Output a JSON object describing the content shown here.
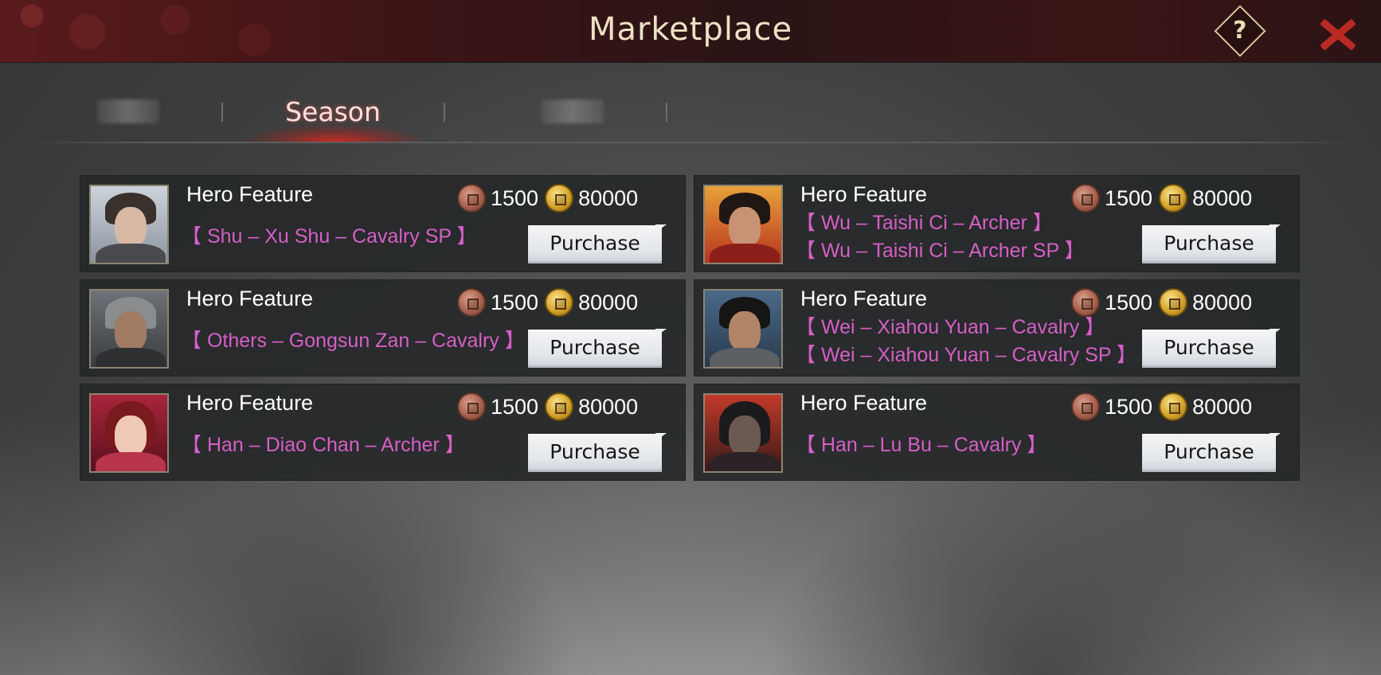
{
  "header": {
    "title": "Marketplace",
    "help_label": "?",
    "help_icon": "help-icon",
    "close_icon": "close-icon",
    "accent_color": "#b92a24"
  },
  "tabs": [
    {
      "label": "",
      "active": false,
      "obscured": true
    },
    {
      "label": "Season",
      "active": true,
      "obscured": false
    },
    {
      "label": "",
      "active": false,
      "obscured": true
    }
  ],
  "currency_icons": {
    "copper": "copper-coin-icon",
    "gold": "gold-coin-icon"
  },
  "items": [
    {
      "title": "Hero Feature",
      "heroes": [
        "【 Shu – Xu Shu – Cavalry SP 】"
      ],
      "copper_price": "1500",
      "gold_price": "80000",
      "button": "Purchase"
    },
    {
      "title": "Hero Feature",
      "heroes": [
        "【 Wu – Taishi Ci – Archer 】",
        "【 Wu – Taishi Ci – Archer SP 】"
      ],
      "copper_price": "1500",
      "gold_price": "80000",
      "button": "Purchase"
    },
    {
      "title": "Hero Feature",
      "heroes": [
        "【 Others – Gongsun Zan – Cavalry 】"
      ],
      "copper_price": "1500",
      "gold_price": "80000",
      "button": "Purchase"
    },
    {
      "title": "Hero Feature",
      "heroes": [
        "【 Wei – Xiahou Yuan – Cavalry 】",
        "【 Wei – Xiahou Yuan – Cavalry SP 】"
      ],
      "copper_price": "1500",
      "gold_price": "80000",
      "button": "Purchase"
    },
    {
      "title": "Hero Feature",
      "heroes": [
        "【 Han – Diao Chan – Archer 】"
      ],
      "copper_price": "1500",
      "gold_price": "80000",
      "button": "Purchase"
    },
    {
      "title": "Hero Feature",
      "heroes": [
        "【 Han – Lu Bu – Cavalry 】"
      ],
      "copper_price": "1500",
      "gold_price": "80000",
      "button": "Purchase"
    }
  ]
}
